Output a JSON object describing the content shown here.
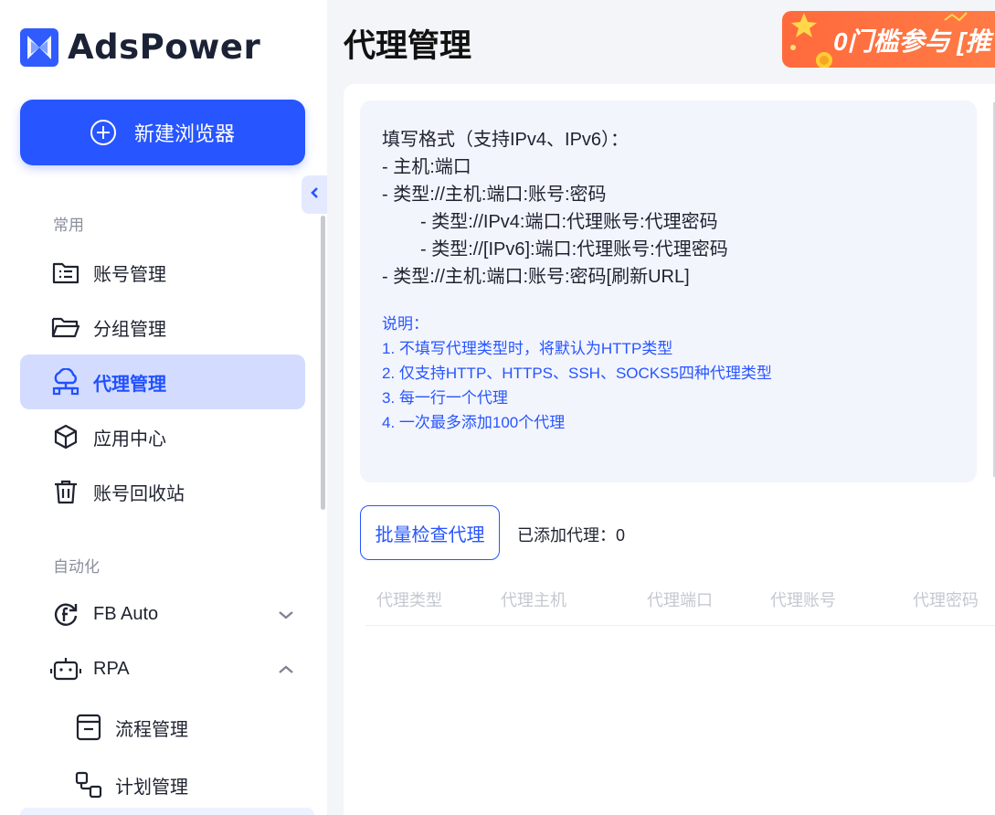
{
  "app": {
    "logo_text": "AdsPower"
  },
  "sidebar": {
    "new_button_label": "新建浏览器",
    "section_common": "常用",
    "section_automation": "自动化",
    "items": [
      {
        "label": "账号管理",
        "icon": "account-list-icon"
      },
      {
        "label": "分组管理",
        "icon": "folder-icon"
      },
      {
        "label": "代理管理",
        "icon": "proxy-cloud-icon",
        "active": true
      },
      {
        "label": "应用中心",
        "icon": "cube-icon"
      },
      {
        "label": "账号回收站",
        "icon": "trash-icon"
      }
    ],
    "automation_items": [
      {
        "label": "FB Auto",
        "icon": "facebook-refresh-icon",
        "expanded": false
      },
      {
        "label": "RPA",
        "icon": "robot-icon",
        "expanded": true
      }
    ],
    "rpa_sub_items": [
      {
        "label": "流程管理",
        "icon": "process-icon"
      },
      {
        "label": "计划管理",
        "icon": "schedule-icon"
      }
    ]
  },
  "main": {
    "title": "代理管理",
    "banner_text": "0门槛参与 [推",
    "format": {
      "heading": "填写格式（支持IPv4、IPv6）：",
      "lines": [
        "- 主机:端口",
        "- 类型://主机:端口:账号:密码",
        "- 类型://IPv4:端口:代理账号:代理密码",
        "- 类型://[IPv6]:端口:代理账号:代理密码",
        "- 类型://主机:端口:账号:密码[刷新URL]"
      ]
    },
    "notes": {
      "heading": "说明：",
      "lines": [
        "1. 不填写代理类型时，将默认为HTTP类型",
        "2. 仅支持HTTP、HTTPS、SSH、SOCKS5四种代理类型",
        "3. 每一行一个代理",
        "4. 一次最多添加100个代理"
      ]
    },
    "batch_check_label": "批量检查代理",
    "added_label": "已添加代理：0",
    "table_headers": [
      "代理类型",
      "代理主机",
      "代理端口",
      "代理账号",
      "代理密码"
    ]
  },
  "colors": {
    "accent": "#2755ff",
    "active_bg": "#d3dcff",
    "banner": "#ff6a3d"
  }
}
